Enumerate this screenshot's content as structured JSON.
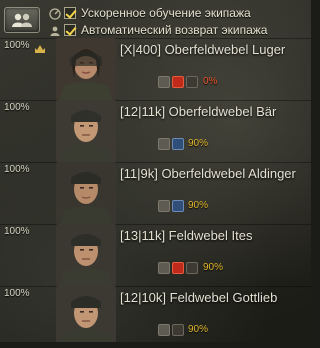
{
  "toolbar": {
    "crew_button_icon": "crew-icon",
    "options": [
      {
        "label": "Ускоренное обучение экипажа",
        "checked": true,
        "icon": "speed-training-icon"
      },
      {
        "label": "Автоматический возврат экипажа",
        "checked": true,
        "icon": "auto-return-icon"
      }
    ]
  },
  "crew": [
    {
      "percent": "100%",
      "name": "[X|400] Oberfeldwebel Luger",
      "specialty_icon": "commander-icon",
      "skill_percent": "0%",
      "skill_color": "#e8542c",
      "skill_progress": 0.0,
      "perks": [
        "gear-perk-icon",
        "red-skill-icon",
        "repair-skill-icon"
      ]
    },
    {
      "percent": "100%",
      "name": "[12|11k] Oberfeldwebel Bär",
      "specialty_icon": "gunner-icon",
      "skill_percent": "90%",
      "skill_color": "#e0b52c",
      "skill_progress": 0.9,
      "perks": [
        "gear-perk-icon",
        "repair-skill-icon"
      ]
    },
    {
      "percent": "100%",
      "name": "[11|9k] Oberfeldwebel Aldinger",
      "specialty_icon": "driver-icon",
      "skill_percent": "90%",
      "skill_color": "#e0b52c",
      "skill_progress": 0.9,
      "perks": [
        "gear-perk-icon",
        "repair-skill-icon"
      ]
    },
    {
      "percent": "100%",
      "name": "[13|11k] Feldwebel Ites",
      "specialty_icon": "radio-icon",
      "skill_percent": "90%",
      "skill_color": "#e0b52c",
      "skill_progress": 0.9,
      "perks": [
        "gear-perk-icon",
        "red-skill-icon",
        "repair-skill-icon"
      ]
    },
    {
      "percent": "100%",
      "name": "[12|10k] Feldwebel Gottlieb",
      "specialty_icon": "loader-icon",
      "skill_percent": "90%",
      "skill_color": "#e0b52c",
      "skill_progress": 0.9,
      "perks": [
        "gear-perk-icon",
        "repair-skill-icon"
      ]
    }
  ]
}
